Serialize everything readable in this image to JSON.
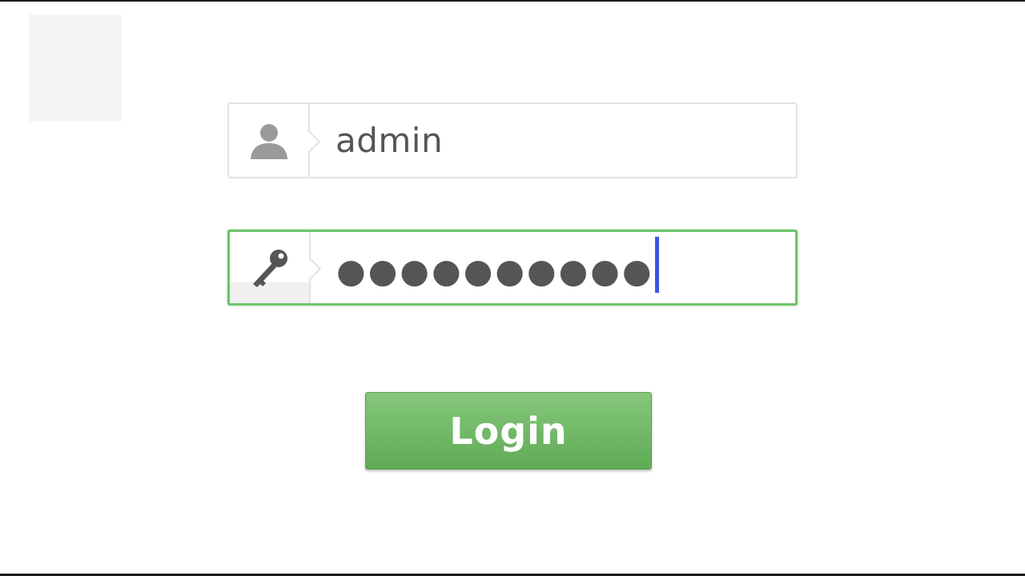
{
  "login_form": {
    "username": {
      "value": "admin",
      "icon": "user-icon"
    },
    "password": {
      "masked_value": "●●●●●●●●●●",
      "icon": "key-icon",
      "focused": true
    },
    "login_button": {
      "label": "Login"
    }
  },
  "colors": {
    "focus_border": "#6cc46a",
    "button_green": "#6bb562",
    "caret": "#3a55e6",
    "icon_gray": "#9a9a9a",
    "text_gray": "#555555"
  }
}
